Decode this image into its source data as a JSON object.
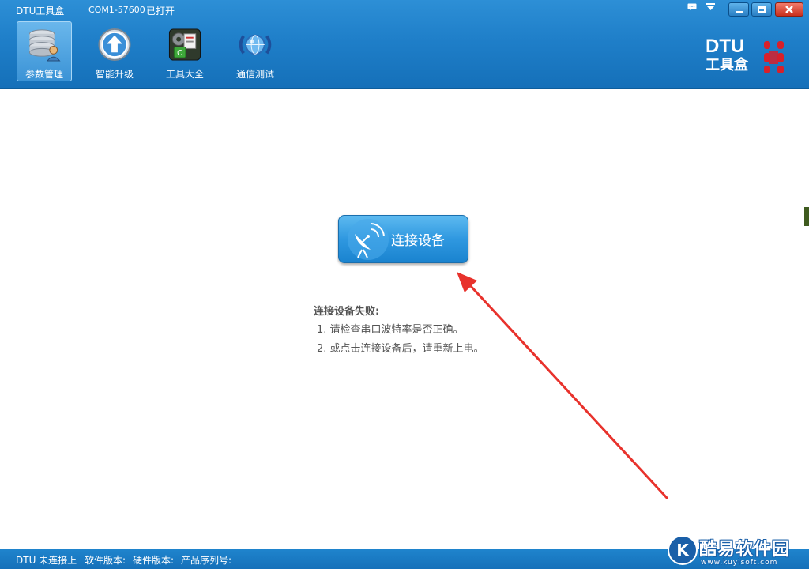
{
  "titlebar": {
    "app_title": "DTU工具盒",
    "com_port": "COM1-57600",
    "port_status": "已打开",
    "icons": [
      "message-icon",
      "menu-icon"
    ]
  },
  "toolbar": {
    "items": [
      {
        "label": "参数管理",
        "icon": "database-user-icon",
        "active": true
      },
      {
        "label": "智能升级",
        "icon": "upgrade-arrow-icon",
        "active": false
      },
      {
        "label": "工具大全",
        "icon": "toolbox-icon",
        "active": false
      },
      {
        "label": "通信测试",
        "icon": "communication-globe-icon",
        "active": false
      }
    ]
  },
  "brand": {
    "line1": "DTU",
    "line2": "工具盒"
  },
  "main": {
    "connect_button": "连接设备",
    "fail_title": "连接设备失败:",
    "hints": [
      "1. 请检查串口波特率是否正确。",
      "2. 或点击连接设备后，请重新上电。"
    ]
  },
  "statusbar": {
    "dtu_status": "DTU 未连接上",
    "software_version_label": "软件版本:",
    "hardware_version_label": "硬件版本:",
    "serial_number_label": "产品序列号:"
  },
  "watermark": {
    "letter": "K",
    "text": "酷易软件园",
    "url": "www.kuyisoft.com"
  },
  "colors": {
    "header_blue": "#1f7fc9",
    "button_blue": "#2f98e0",
    "arrow_red": "#e8322c",
    "text_gray": "#555555"
  }
}
